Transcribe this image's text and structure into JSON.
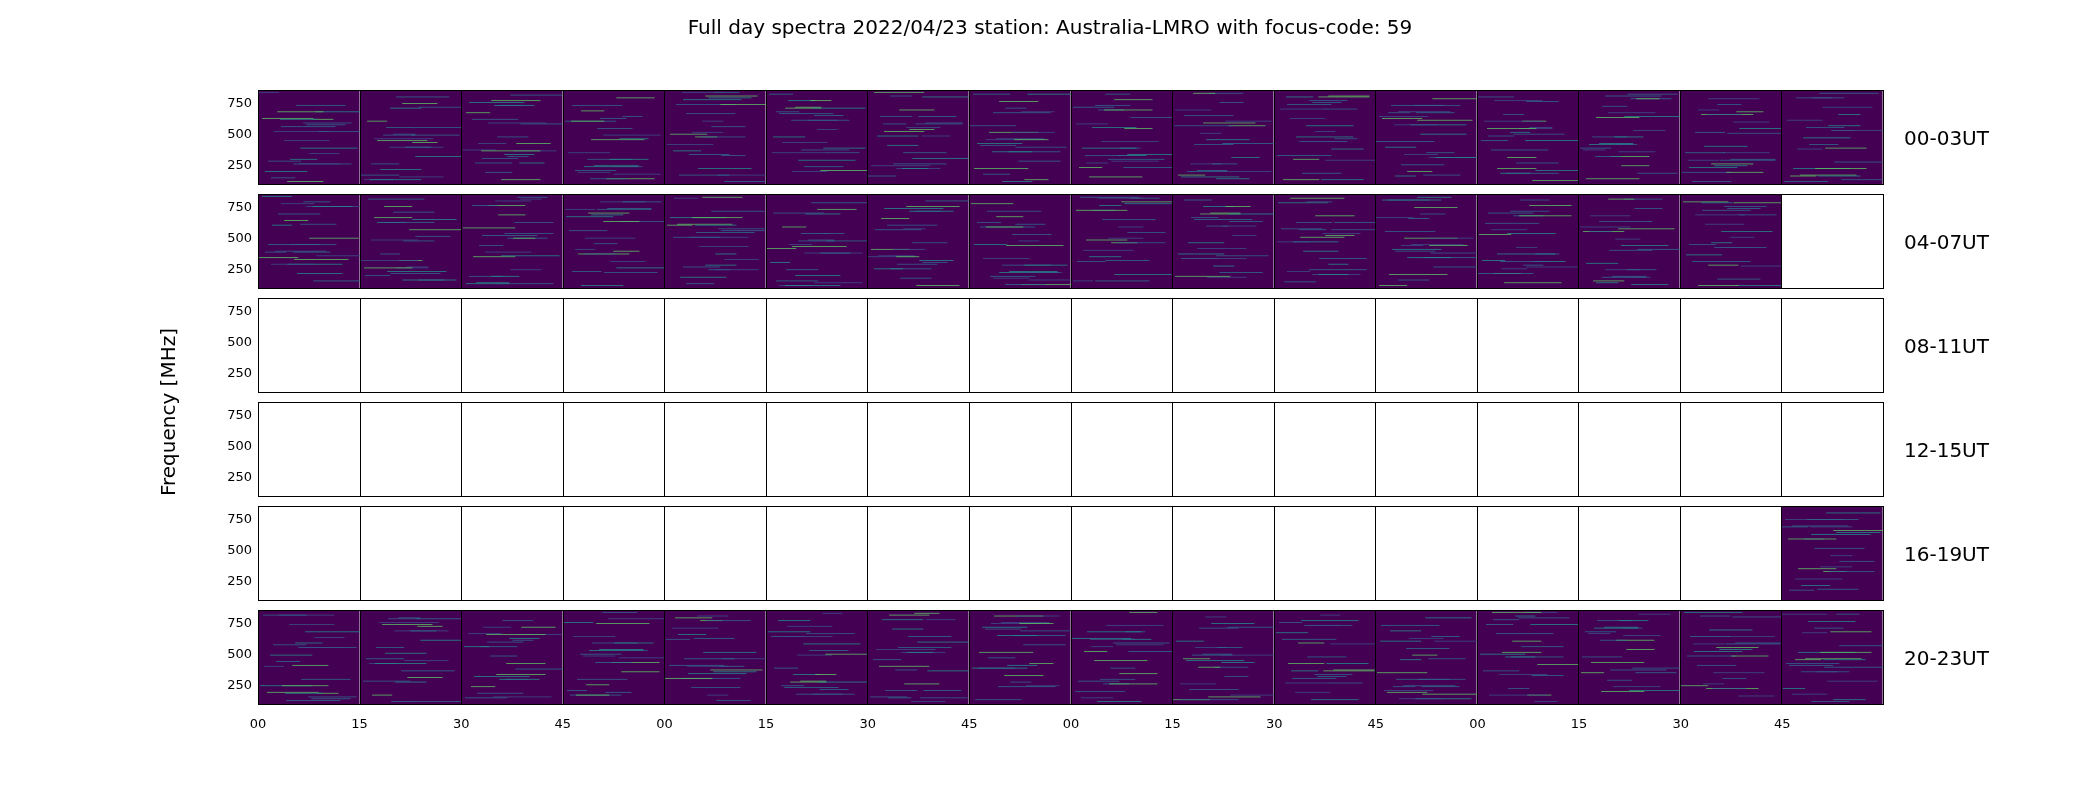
{
  "title": "Full day spectra 2022/04/23 station: Australia-LMRO with focus-code: 59",
  "ylabel": "Frequency [MHz]",
  "yticks": [
    [
      "750",
      "500",
      "250"
    ],
    [
      "750",
      "500",
      "250"
    ],
    [
      "750",
      "500",
      "250"
    ],
    [
      "750",
      "500",
      "250"
    ],
    [
      "750",
      "500",
      "250"
    ],
    [
      "750",
      "500",
      "250"
    ]
  ],
  "xticks": [
    "00",
    "15",
    "30",
    "45",
    "00",
    "15",
    "30",
    "45",
    "00",
    "15",
    "30",
    "45",
    "00",
    "15",
    "30",
    "45"
  ],
  "rows": [
    {
      "label": "00-03UT",
      "panels": [
        {
          "filled": true
        },
        {
          "filled": true
        },
        {
          "filled": true
        },
        {
          "filled": true
        },
        {
          "filled": true
        },
        {
          "filled": true
        },
        {
          "filled": true
        },
        {
          "filled": true
        },
        {
          "filled": true
        },
        {
          "filled": true
        },
        {
          "filled": true
        },
        {
          "filled": true
        },
        {
          "filled": true
        },
        {
          "filled": true
        },
        {
          "filled": true
        },
        {
          "filled": true
        }
      ]
    },
    {
      "label": "04-07UT",
      "panels": [
        {
          "filled": true
        },
        {
          "filled": true
        },
        {
          "filled": true
        },
        {
          "filled": true
        },
        {
          "filled": true
        },
        {
          "filled": true
        },
        {
          "filled": true
        },
        {
          "filled": true
        },
        {
          "filled": true
        },
        {
          "filled": true
        },
        {
          "filled": true
        },
        {
          "filled": true
        },
        {
          "filled": true
        },
        {
          "filled": true
        },
        {
          "filled": true
        },
        {
          "filled": false
        }
      ]
    },
    {
      "label": "08-11UT",
      "panels": [
        {
          "filled": false
        },
        {
          "filled": false
        },
        {
          "filled": false
        },
        {
          "filled": false
        },
        {
          "filled": false
        },
        {
          "filled": false
        },
        {
          "filled": false
        },
        {
          "filled": false
        },
        {
          "filled": false
        },
        {
          "filled": false
        },
        {
          "filled": false
        },
        {
          "filled": false
        },
        {
          "filled": false
        },
        {
          "filled": false
        },
        {
          "filled": false
        },
        {
          "filled": false
        }
      ]
    },
    {
      "label": "12-15UT",
      "panels": [
        {
          "filled": false
        },
        {
          "filled": false
        },
        {
          "filled": false
        },
        {
          "filled": false
        },
        {
          "filled": false
        },
        {
          "filled": false
        },
        {
          "filled": false
        },
        {
          "filled": false
        },
        {
          "filled": false
        },
        {
          "filled": false
        },
        {
          "filled": false
        },
        {
          "filled": false
        },
        {
          "filled": false
        },
        {
          "filled": false
        },
        {
          "filled": false
        },
        {
          "filled": false
        }
      ]
    },
    {
      "label": "16-19UT",
      "panels": [
        {
          "filled": false
        },
        {
          "filled": false
        },
        {
          "filled": false
        },
        {
          "filled": false
        },
        {
          "filled": false
        },
        {
          "filled": false
        },
        {
          "filled": false
        },
        {
          "filled": false
        },
        {
          "filled": false
        },
        {
          "filled": false
        },
        {
          "filled": false
        },
        {
          "filled": false
        },
        {
          "filled": false
        },
        {
          "filled": false
        },
        {
          "filled": false
        },
        {
          "filled": true
        }
      ]
    },
    {
      "label": "20-23UT",
      "panels": [
        {
          "filled": true
        },
        {
          "filled": true
        },
        {
          "filled": true
        },
        {
          "filled": true
        },
        {
          "filled": true
        },
        {
          "filled": true
        },
        {
          "filled": true
        },
        {
          "filled": true
        },
        {
          "filled": true
        },
        {
          "filled": true
        },
        {
          "filled": true
        },
        {
          "filled": true
        },
        {
          "filled": true
        },
        {
          "filled": true
        },
        {
          "filled": true
        },
        {
          "filled": true
        }
      ]
    }
  ]
}
